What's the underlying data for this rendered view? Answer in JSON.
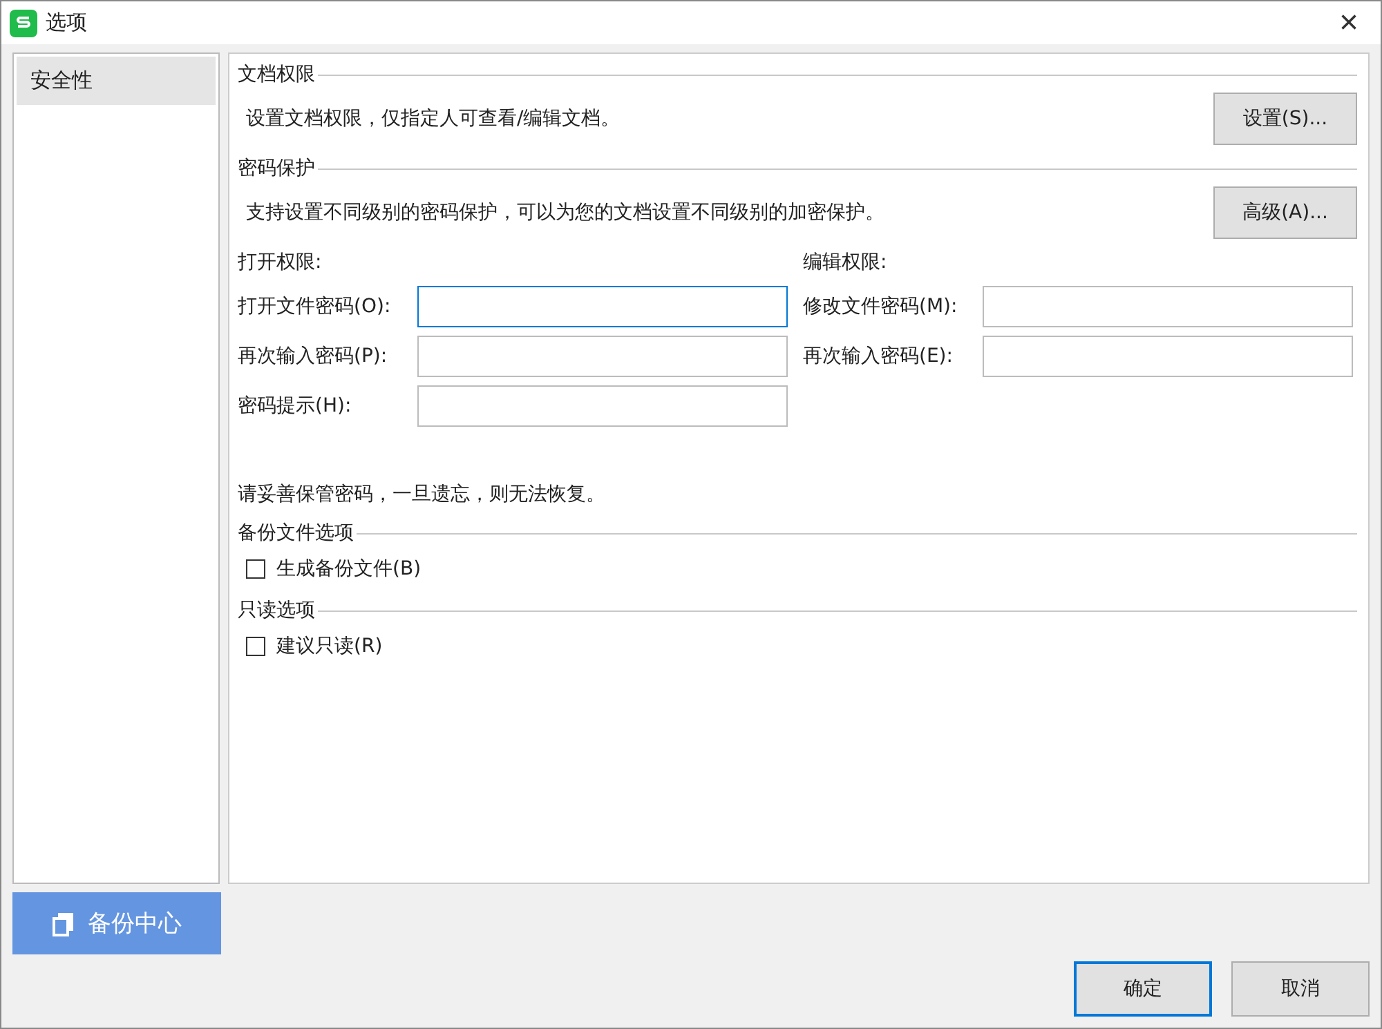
{
  "window": {
    "title": "选项",
    "close": "×"
  },
  "sidebar": {
    "items": [
      {
        "label": "安全性",
        "selected": true
      }
    ]
  },
  "sections": [
    {
      "title": "文档权限",
      "description": "设置文档权限，仅指定人可查看/编辑文档。",
      "button": "设置(S)..."
    },
    {
      "title": "密码保护",
      "description": "支持设置不同级别的密码保护，可以为您的文档设置不同级别的加密保护。",
      "button": "高级(A)..."
    }
  ],
  "password_groups": [
    {
      "title": "打开权限:",
      "fields": [
        {
          "label": "打开文件密码(O):",
          "focused": true
        },
        {
          "label": "再次输入密码(P):",
          "focused": false
        },
        {
          "label": "密码提示(H):",
          "focused": false
        }
      ]
    },
    {
      "title": "编辑权限:",
      "fields": [
        {
          "label": "修改文件密码(M):",
          "focused": false
        },
        {
          "label": "再次输入密码(E):",
          "focused": false
        }
      ]
    }
  ],
  "warning": "请妥善保管密码，一旦遗忘，则无法恢复。",
  "option_sections": [
    {
      "title": "备份文件选项",
      "checkbox": {
        "label": "生成备份文件(B)",
        "checked": false
      }
    },
    {
      "title": "只读选项",
      "checkbox": {
        "label": "建议只读(R)",
        "checked": false
      }
    }
  ],
  "backup_button": "备份中心",
  "buttons": [
    {
      "label": "确定",
      "default": true
    },
    {
      "label": "取消",
      "default": false
    }
  ]
}
